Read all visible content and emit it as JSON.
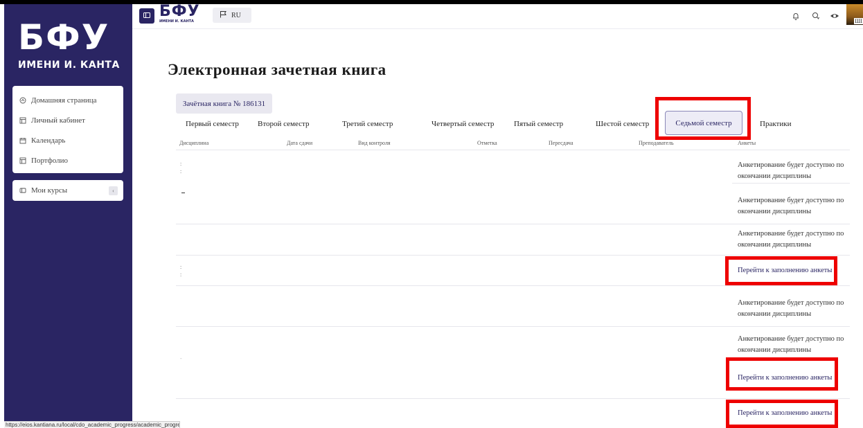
{
  "brand": {
    "big": "БФУ",
    "small": "ИМЕНИ И. КАНТА",
    "header_big": "БФУ",
    "header_small": "ИМЕНИ И. КАНТА"
  },
  "sidebar": {
    "items": [
      {
        "label": "Домашняя страница",
        "icon": "home-icon"
      },
      {
        "label": "Личный кабинет",
        "icon": "cabinet-icon"
      },
      {
        "label": "Календарь",
        "icon": "calendar-icon"
      },
      {
        "label": "Портфолио",
        "icon": "portfolio-icon"
      }
    ],
    "courses": {
      "label": "Мои курсы",
      "badge": "‹"
    }
  },
  "header": {
    "lang": "RU",
    "icons": [
      "bell-icon",
      "chat-icon",
      "eye-icon"
    ],
    "avatar_label": "ШІ"
  },
  "page": {
    "title": "Электронная зачетная книга",
    "book_tab": "Зачётная книга № 186131"
  },
  "semesters": [
    "Первый семестр",
    "Второй семестр",
    "Третий семестр",
    "Четвертый семестр",
    "Пятый семестр",
    "Шестой семестр",
    "Седьмой семестр",
    "Практики"
  ],
  "active_semester": "Седьмой семестр",
  "columns": [
    "Дисциплина",
    "Дата сдачи",
    "Вид контроля",
    "Отметка",
    "Пересдача",
    "Преподаватель",
    "Анкеты"
  ],
  "rows": [
    {
      "survey": "Анкетирование будет доступно по окончании дисциплины",
      "is_link": false
    },
    {
      "survey": "Анкетирование будет доступно по окончании дисциплины",
      "is_link": false
    },
    {
      "survey": "Анкетирование будет доступно по окончании дисциплины",
      "is_link": false
    },
    {
      "survey": "Перейти к заполнению анкеты",
      "is_link": true
    },
    {
      "survey": "Анкетирование будет доступно по окончании дисциплины",
      "is_link": false
    },
    {
      "survey": "Анкетирование будет доступно по окончании дисциплины",
      "is_link": false
    },
    {
      "survey": "Перейти к заполнению анкеты",
      "is_link": true
    },
    {
      "survey": "Перейти к заполнению анкеты",
      "is_link": true
    }
  ],
  "status_url": "https://eios.kantiana.ru/local/cdo_academic_progress/academic_progress",
  "colors": {
    "sidebar": "#2a2563",
    "highlight": "#ee0000",
    "link": "#2a2563"
  }
}
